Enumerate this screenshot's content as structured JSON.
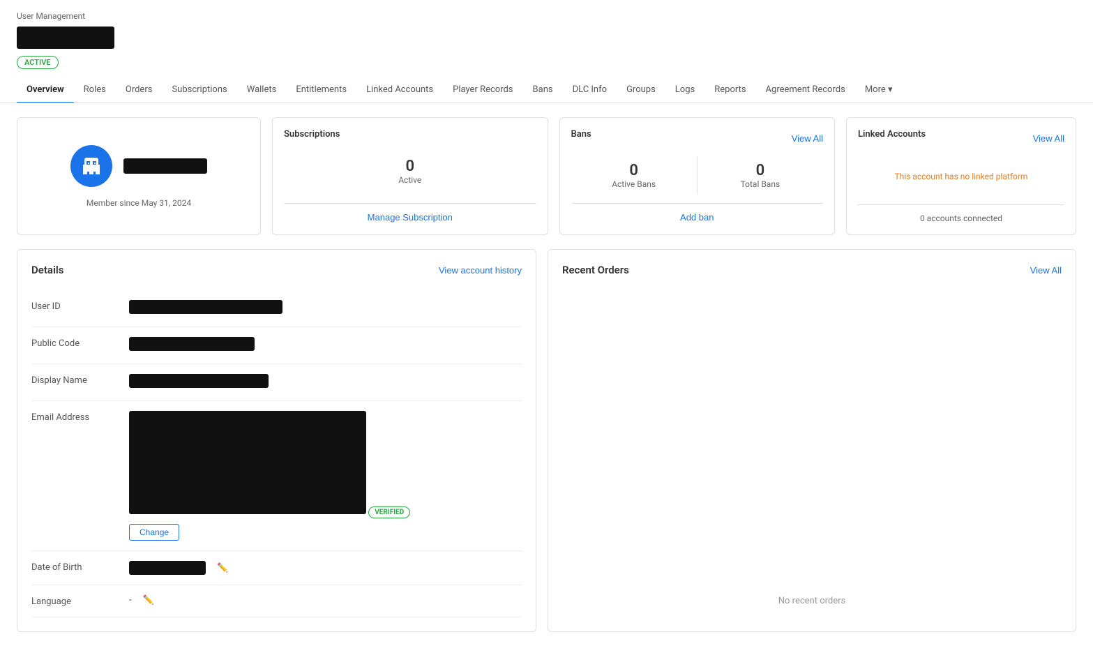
{
  "breadcrumb": "User Management",
  "status_badge": "ACTIVE",
  "nav": {
    "tabs": [
      {
        "id": "overview",
        "label": "Overview",
        "active": true
      },
      {
        "id": "roles",
        "label": "Roles"
      },
      {
        "id": "orders",
        "label": "Orders"
      },
      {
        "id": "subscriptions",
        "label": "Subscriptions"
      },
      {
        "id": "wallets",
        "label": "Wallets"
      },
      {
        "id": "entitlements",
        "label": "Entitlements"
      },
      {
        "id": "linked-accounts",
        "label": "Linked Accounts"
      },
      {
        "id": "player-records",
        "label": "Player Records"
      },
      {
        "id": "bans",
        "label": "Bans"
      },
      {
        "id": "dlc-info",
        "label": "DLC Info"
      },
      {
        "id": "groups",
        "label": "Groups"
      },
      {
        "id": "logs",
        "label": "Logs"
      },
      {
        "id": "reports",
        "label": "Reports"
      },
      {
        "id": "agreement-records",
        "label": "Agreement Records"
      },
      {
        "id": "more",
        "label": "More ▾"
      }
    ]
  },
  "profile": {
    "member_since": "Member since May 31, 2024"
  },
  "subscriptions": {
    "title": "Subscriptions",
    "active_count": "0",
    "active_label": "Active",
    "manage_label": "Manage Subscription"
  },
  "bans": {
    "title": "Bans",
    "view_all": "View All",
    "active_count": "0",
    "active_label": "Active Bans",
    "total_count": "0",
    "total_label": "Total Bans",
    "add_ban": "Add ban"
  },
  "linked": {
    "title": "Linked Accounts",
    "view_all": "View All",
    "no_platform_msg": "This account has no linked platform",
    "accounts_connected": "0 accounts connected"
  },
  "details": {
    "title": "Details",
    "view_history": "View account history",
    "fields": [
      {
        "label": "User ID",
        "type": "redacted-block"
      },
      {
        "label": "Public Code",
        "type": "redacted-block"
      },
      {
        "label": "Display Name",
        "type": "redacted-block"
      },
      {
        "label": "Email Address",
        "type": "email-special"
      },
      {
        "label": "Date of Birth",
        "type": "dob-special"
      },
      {
        "label": "Language",
        "type": "language-special",
        "value": "-"
      }
    ],
    "verified_badge": "VERIFIED",
    "change_label": "Change"
  },
  "orders": {
    "title": "Recent Orders",
    "view_all": "View All",
    "empty_message": "No recent orders"
  }
}
